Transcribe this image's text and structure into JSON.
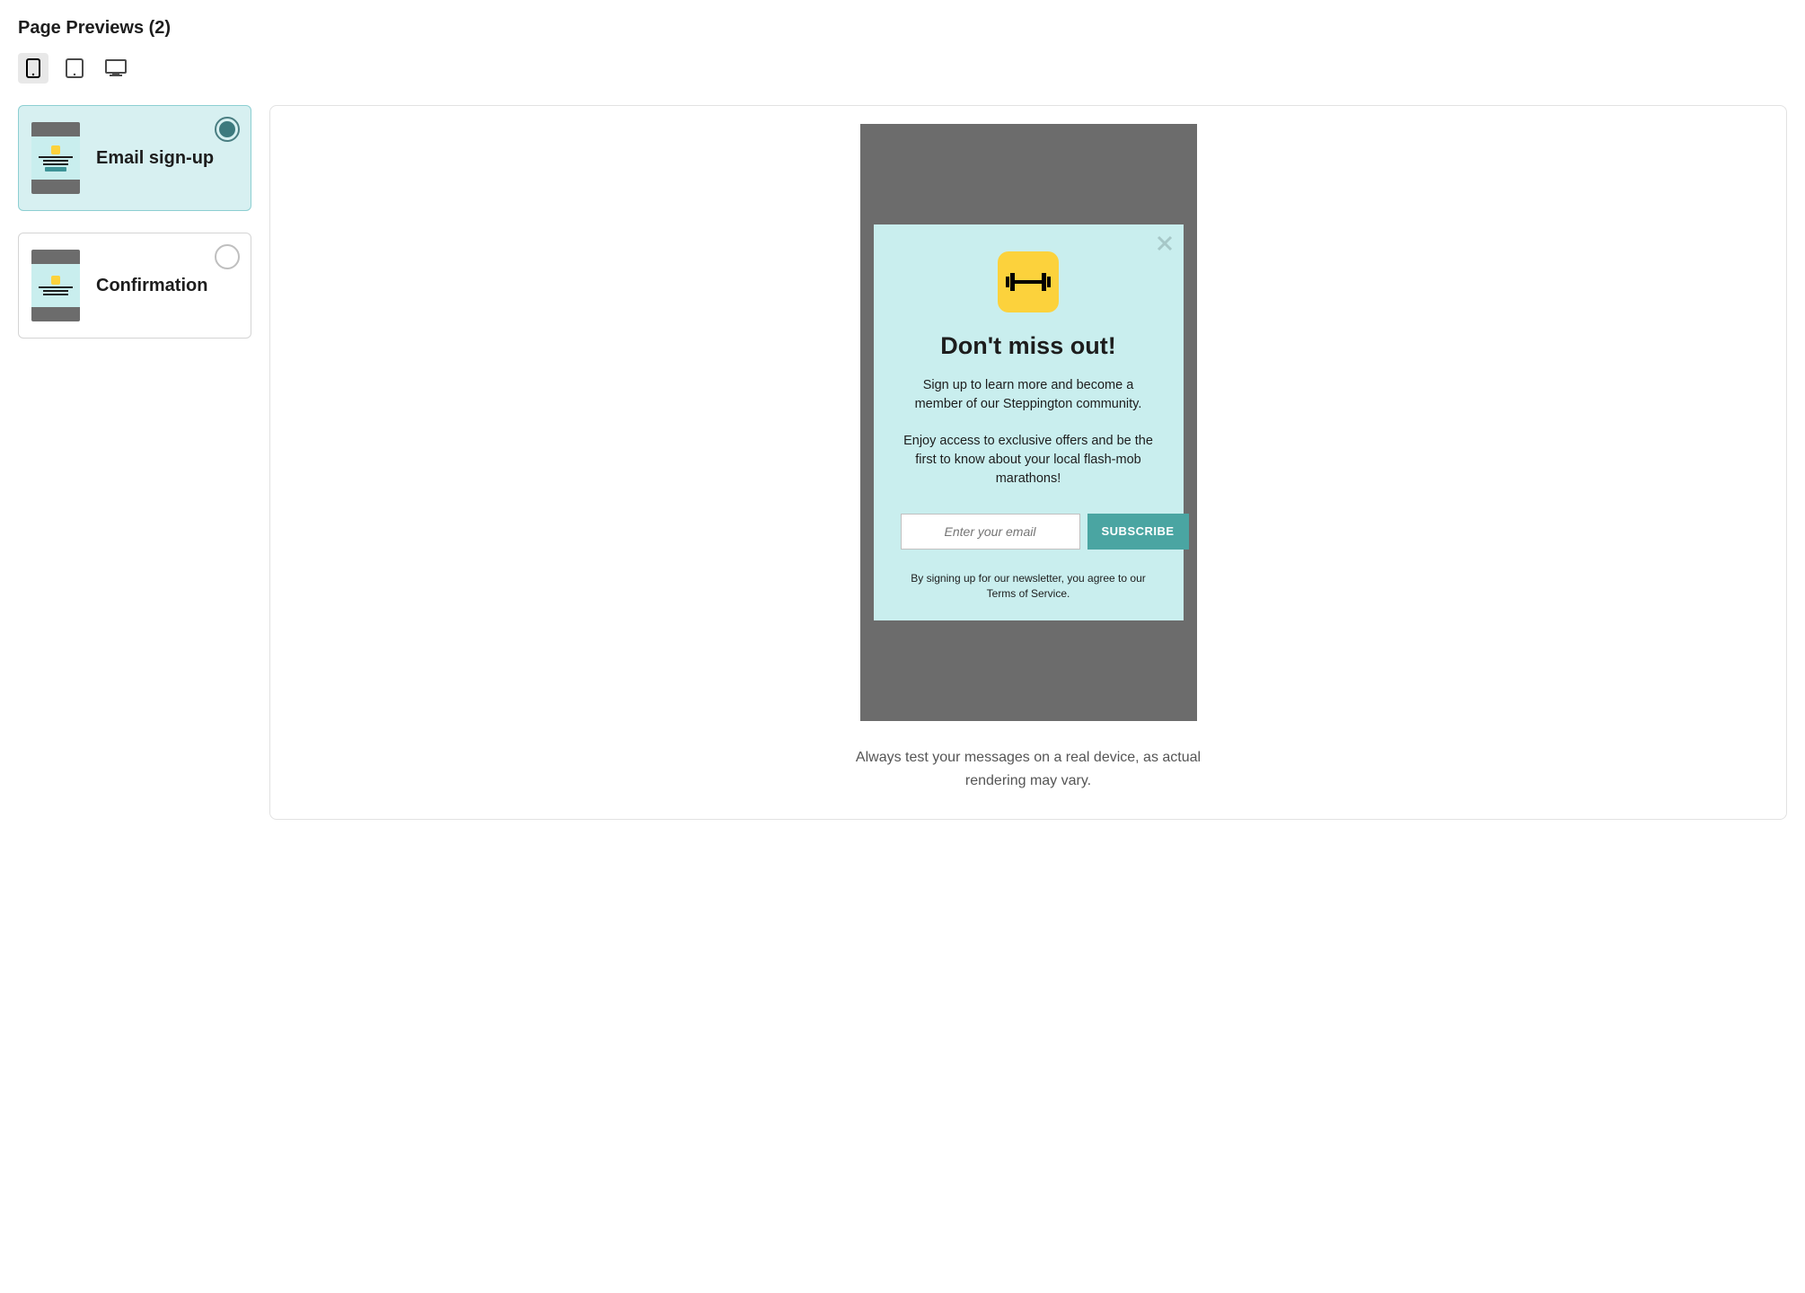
{
  "title": "Page Previews (2)",
  "devices": [
    {
      "name": "mobile",
      "active": true
    },
    {
      "name": "tablet",
      "active": false
    },
    {
      "name": "desktop",
      "active": false
    }
  ],
  "pages": [
    {
      "label": "Email sign-up",
      "selected": true
    },
    {
      "label": "Confirmation",
      "selected": false
    }
  ],
  "preview": {
    "popup": {
      "heading": "Don't miss out!",
      "body_p1": "Sign up to learn more and become a member of our Steppington community.",
      "body_p2": "Enjoy access to exclusive offers and be the first to know about your local flash-mob marathons!",
      "email_placeholder": "Enter your email",
      "subscribe_label": "SUBSCRIBE",
      "footer": "By signing up for our newsletter, you agree to our Terms of Service."
    },
    "note": "Always test your messages on a real device, as actual rendering may vary."
  }
}
